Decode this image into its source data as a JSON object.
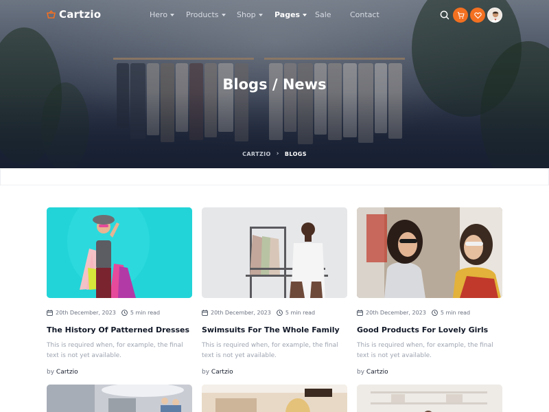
{
  "brand": {
    "name": "Cartzio",
    "accent": "#f37021"
  },
  "nav": {
    "items": [
      {
        "label": "Hero",
        "caret": true
      },
      {
        "label": "Products",
        "caret": true
      },
      {
        "label": "Shop",
        "caret": true
      },
      {
        "label": "Pages",
        "caret": true,
        "active": true
      },
      {
        "label": "Sale",
        "caret": false
      },
      {
        "label": "Contact",
        "caret": false
      }
    ],
    "icons": [
      "search-icon",
      "cart-icon",
      "heart-icon",
      "avatar"
    ]
  },
  "hero": {
    "title": "Blogs / News",
    "breadcrumb": [
      "CARTZIO",
      "BLOGS"
    ]
  },
  "posts": [
    {
      "date": "20th December, 2023",
      "read": "5 min read",
      "title": "The History Of Patterned Dresses",
      "excerpt": "This is required when, for example, the final text is not yet available.",
      "by": "by",
      "author": "Cartzio"
    },
    {
      "date": "20th December, 2023",
      "read": "5 min read",
      "title": "Swimsuits For The Whole Family",
      "excerpt": "This is required when, for example, the final text is not yet available.",
      "by": "by",
      "author": "Cartzio"
    },
    {
      "date": "20th December, 2023",
      "read": "5 min read",
      "title": "Good Products For Lovely Girls",
      "excerpt": "This is required when, for example, the final text is not yet available.",
      "by": "by",
      "author": "Cartzio"
    }
  ]
}
